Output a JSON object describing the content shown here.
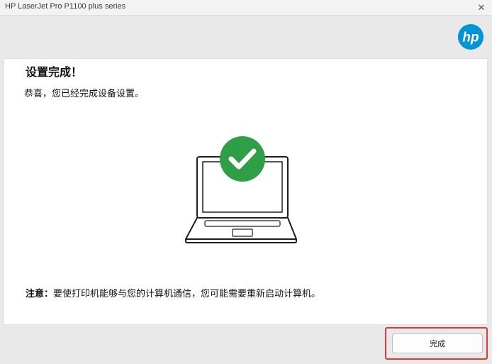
{
  "window": {
    "title": "HP LaserJet Pro P1100 plus series",
    "close_glyph": "✕"
  },
  "brand": {
    "logo_text": "hp",
    "logo_color": "#0096d6"
  },
  "content": {
    "heading": "设置完成！",
    "subtitle": "恭喜，您已经完成设备设置。",
    "note_label": "注意：",
    "note_text": "要使打印机能够与您的计算机通信，您可能需要重新启动计算机。",
    "illustration_icons": [
      "laptop-icon",
      "check-circle-icon"
    ],
    "success_color": "#2e9e47"
  },
  "footer": {
    "finish_label": "完成",
    "highlight_color": "#e53935"
  }
}
